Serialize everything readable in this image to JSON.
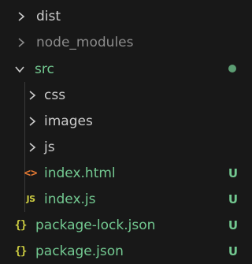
{
  "explorer": {
    "items": [
      {
        "label": "dist",
        "type": "folder",
        "expanded": false,
        "icon": "chevron-right-icon"
      },
      {
        "label": "node_modules",
        "type": "folder",
        "expanded": false,
        "dimmed": true,
        "icon": "chevron-right-icon"
      },
      {
        "label": "src",
        "type": "folder",
        "expanded": true,
        "icon": "chevron-down-icon",
        "status": "modified-dot"
      },
      {
        "label": "css",
        "type": "folder",
        "expanded": false,
        "icon": "chevron-right-icon"
      },
      {
        "label": "images",
        "type": "folder",
        "expanded": false,
        "icon": "chevron-right-icon"
      },
      {
        "label": "js",
        "type": "folder",
        "expanded": false,
        "icon": "chevron-right-icon"
      },
      {
        "label": "index.html",
        "type": "file",
        "icon": "html-file-icon",
        "icon_glyph": "<>",
        "badge": "U"
      },
      {
        "label": "index.js",
        "type": "file",
        "icon": "js-file-icon",
        "icon_glyph": "JS",
        "badge": "U"
      },
      {
        "label": "package-lock.json",
        "type": "file",
        "icon": "json-file-icon",
        "icon_glyph": "{}",
        "badge": "U"
      },
      {
        "label": "package.json",
        "type": "file",
        "icon": "json-file-icon",
        "icon_glyph": "{}",
        "badge": "U"
      }
    ]
  },
  "colors": {
    "background": "#181818",
    "text": "#cccccc",
    "dimmed_text": "#8c8c8c",
    "untracked": "#73c991",
    "html_icon": "#e37933",
    "json_icon": "#cbcb41"
  }
}
